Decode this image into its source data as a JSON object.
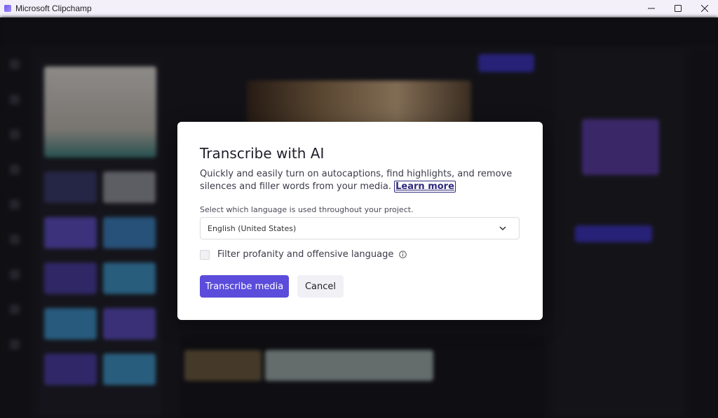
{
  "window": {
    "title": "Microsoft Clipchamp",
    "icon": "clipchamp-icon"
  },
  "dialog": {
    "title": "Transcribe with AI",
    "description": "Quickly and easily turn on autocaptions, find highlights, and remove silences and filler words from your media.",
    "learn_more": "Learn more",
    "language_label": "Select which language is used throughout your project.",
    "language_value": "English (United States)",
    "filter_label": "Filter profanity and offensive language",
    "filter_checked": false,
    "primary_button": "Transcribe media",
    "cancel_button": "Cancel"
  },
  "colors": {
    "accent": "#5b4cdb",
    "background_app": "#1c1b23"
  }
}
